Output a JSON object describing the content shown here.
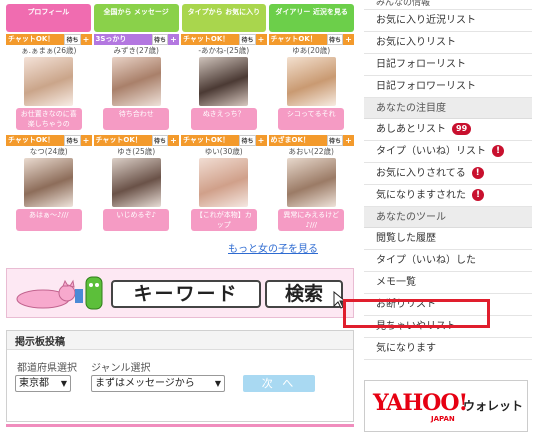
{
  "banners": [
    {
      "text": "プロフィール"
    },
    {
      "text": "全国から\nメッセージ"
    },
    {
      "text": "タイプから\nお気に入り"
    },
    {
      "text": "ダイアリー\n近況を見る"
    }
  ],
  "cards_row1": [
    {
      "tag": "チャットOK！",
      "status": "待ち",
      "name": "ぁ.ぁまぁ(26歳)",
      "caption": "お仕置きなのに喜楽しちゃうの",
      "photo": "p1"
    },
    {
      "tag": "3Sっかり",
      "status": "待ち",
      "name": "みずき(27歳)",
      "caption": "待ち合わせ",
      "photo": "p2"
    },
    {
      "tag": "チャットOK！",
      "status": "待ち",
      "name": "-あかね-(25歳)",
      "caption": "ぬきえっち？",
      "photo": "p3"
    },
    {
      "tag": "チャットOK！",
      "status": "待ち",
      "name": "ゆあ(20歳)",
      "caption": "シコってるそれ",
      "photo": "p4"
    }
  ],
  "cards_row2": [
    {
      "tag": "チャットOK！",
      "status": "待ち",
      "name": "なつ(24歳)",
      "caption": "あはぁ～♪///",
      "photo": "p5"
    },
    {
      "tag": "チャットOK！",
      "status": "待ち",
      "name": "ゆき(25歳)",
      "caption": "いじめるぞ♪",
      "photo": "p6"
    },
    {
      "tag": "チャットOK！",
      "status": "待ち",
      "name": "ゆい(30歳)",
      "caption": "【これが本物】カップ",
      "photo": "p7"
    },
    {
      "tag": "めざまOK！",
      "status": "待ち",
      "name": "あおい(22歳)",
      "caption": "異常にみえるけど♪///",
      "photo": "p8"
    }
  ],
  "more_link": "もっと女の子を見る",
  "keyword_banner": {
    "keyword": "キーワード",
    "search": "検索"
  },
  "board": {
    "title": "掲示板投稿",
    "pref_label": "都道府県選択",
    "genre_label": "ジャンル選択",
    "pref_value": "東京都",
    "genre_value": "まずはメッセージから",
    "next_label": "次 へ"
  },
  "sidebar": {
    "top_partial": "みんなの情報",
    "items_a": [
      "お気に入り近況リスト",
      "お気に入りリスト",
      "日記フォローリスト",
      "日記フォロワーリスト"
    ],
    "head_attention": "あなたの注目度",
    "attention": [
      {
        "label": "あしあとリスト",
        "badge": "99",
        "type": "num"
      },
      {
        "label": "タイプ（いいね）リスト",
        "badge": "!",
        "type": "excl"
      },
      {
        "label": "お気に入りされてる",
        "badge": "!",
        "type": "excl"
      },
      {
        "label": "気になりますされた",
        "badge": "!",
        "type": "excl"
      }
    ],
    "head_tools": "あなたのツール",
    "tools": [
      "閲覧した履歴",
      "タイプ（いいね）した",
      "メモ一覧",
      "お断りリスト",
      "見ちゃいやリスト",
      "気になります"
    ]
  },
  "yahoo": {
    "logo": "YAHOO!",
    "sub": "JAPAN",
    "wallet": "ウォレット"
  },
  "colors": {
    "highlight": "#e01e2d",
    "badge": "#c8102e",
    "link": "#2e6bd1",
    "caption": "#f59bc4"
  }
}
